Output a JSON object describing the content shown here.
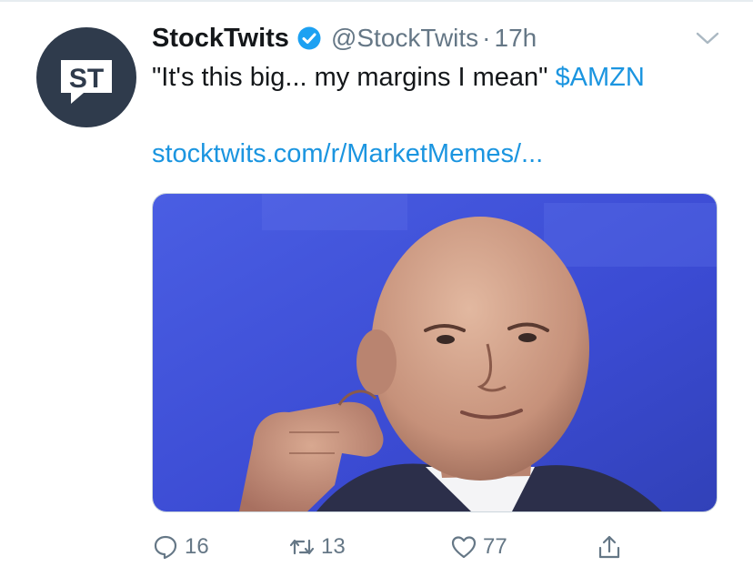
{
  "tweet": {
    "author_name": "StockTwits",
    "author_handle": "@StockTwits",
    "separator": "·",
    "time": "17h",
    "avatar_text": "ST",
    "text": "\"It's this big... my margins I mean\"",
    "cashtag": "$AMZN",
    "link": "stocktwits.com/r/MarketMemes/..."
  },
  "actions": {
    "replies": "16",
    "retweets": "13",
    "likes": "77"
  },
  "icons": {
    "verified": "verified-badge-icon",
    "caret": "chevron-down-icon",
    "reply": "reply-icon",
    "retweet": "retweet-icon",
    "like": "heart-icon",
    "share": "share-icon"
  },
  "colors": {
    "link_blue": "#1b95e0",
    "muted_gray": "#657786",
    "avatar_bg": "#2f3b4c",
    "photo_backdrop": "#3f4fd8"
  }
}
